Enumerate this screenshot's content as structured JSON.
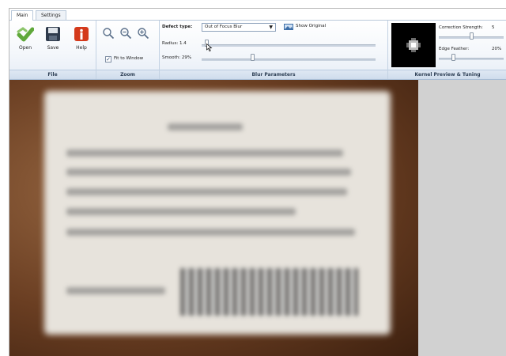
{
  "tabs": [
    {
      "label": "Main",
      "active": true
    },
    {
      "label": "Settings",
      "active": false
    }
  ],
  "file_group": {
    "label": "File",
    "buttons": [
      {
        "label": "Open",
        "icon": "open-check-icon"
      },
      {
        "label": "Save",
        "icon": "floppy-disk-icon"
      },
      {
        "label": "Help",
        "icon": "info-icon"
      }
    ]
  },
  "zoom_group": {
    "label": "Zoom",
    "icons": [
      "zoom-icon",
      "zoom-out-icon",
      "zoom-in-icon"
    ],
    "fit_to_window": {
      "label": "Fit to Window",
      "checked": true
    }
  },
  "blur_group": {
    "label": "Blur Parameters",
    "defect_type_label": "Defect type:",
    "defect_type_value": "Out of Focus Blur",
    "show_original_label": "Show Original",
    "radius_label": "Radius: 1.4",
    "radius_value": 1.4,
    "smooth_label": "Smooth: 29%",
    "smooth_value": 0.29
  },
  "kernel_group": {
    "label": "Kernel Preview & Tuning",
    "correction_strength_label": "Correction Strength:",
    "correction_strength_value": "5",
    "edge_feather_label": "Edge Feather:",
    "edge_feather_value": "20%"
  },
  "colors": {
    "ribbon_border": "#a9bdd4",
    "canvas_bg": "#d1d1d1",
    "open_icon_green": "#5fa83a",
    "help_icon_red": "#d43a1c"
  }
}
